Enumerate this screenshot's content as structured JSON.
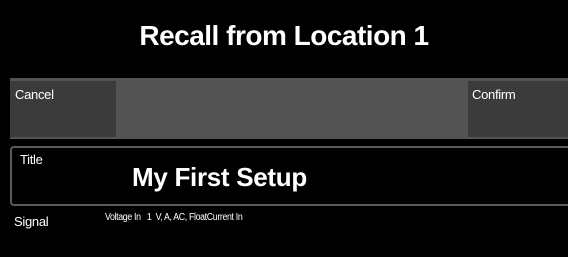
{
  "header": {
    "title": "Recall from Location 1"
  },
  "actions": {
    "cancel_label": "Cancel",
    "confirm_label": "Confirm"
  },
  "title_field": {
    "label": "Title",
    "value": "My First Setup"
  },
  "signal": {
    "label": "Signal",
    "value": "Voltage In   1  V, A, AC, FloatCurrent In"
  },
  "colors": {
    "background": "#000000",
    "action_bar": "#535353",
    "button": "#3b3b3b",
    "field_border": "#5a5a5a",
    "text": "#ffffff"
  }
}
